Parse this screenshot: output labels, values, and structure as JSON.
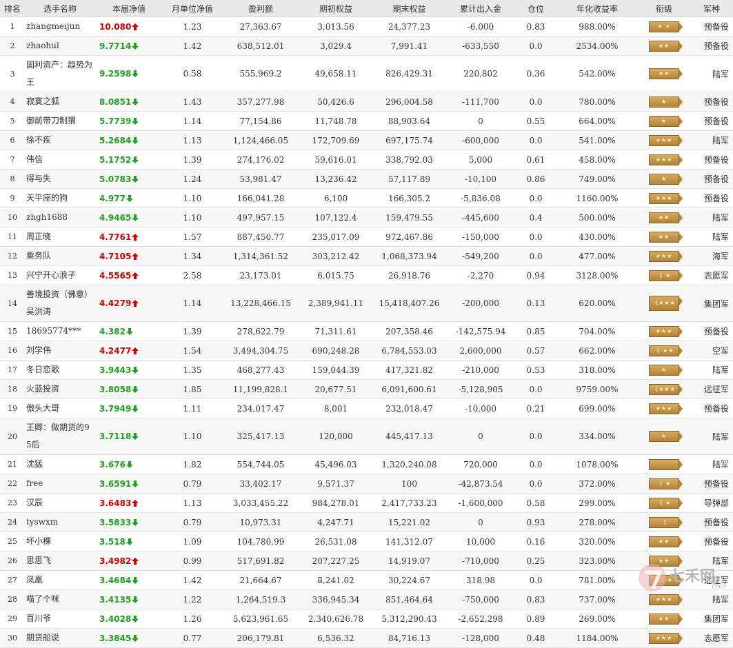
{
  "headers": [
    "排名",
    "选手名称",
    "本届净值",
    "月单位净值",
    "盈利额",
    "期初权益",
    "期末权益",
    "累计出入金",
    "仓位",
    "年化收益率",
    "衔级",
    "军种"
  ],
  "rows": [
    {
      "rank": "1",
      "name": "zhangmeijun",
      "nav": "10.080",
      "trend": "up",
      "monthly": "1.23",
      "profit": "27,363.67",
      "start": "3,013.56",
      "end": "24,377.23",
      "flow": "-6,000",
      "position": "0.83",
      "annual": "988.00%",
      "badge": "✦  ✦",
      "army": "预备役"
    },
    {
      "rank": "2",
      "name": "zhaohui",
      "nav": "9.7714",
      "trend": "down",
      "monthly": "1.42",
      "profit": "638,512.01",
      "start": "3,029.4",
      "end": "7,991.41",
      "flow": "-633,550",
      "position": "0.0",
      "annual": "2534.00%",
      "badge": "★★",
      "army": "预备役"
    },
    {
      "rank": "3",
      "name": "固利资产：趋势为王",
      "nav": "9.2598",
      "trend": "down",
      "monthly": "0.58",
      "profit": "555,969.2",
      "start": "49,658.11",
      "end": "826,429.31",
      "flow": "220,802",
      "position": "0.36",
      "annual": "542.00%",
      "badge": "★★",
      "army": "陆军"
    },
    {
      "rank": "4",
      "name": "寂寞之狐",
      "nav": "8.0851",
      "trend": "down",
      "monthly": "1.43",
      "profit": "357,277.98",
      "start": "50,426.6",
      "end": "296,004.58",
      "flow": "-111,700",
      "position": "0.0",
      "annual": "780.00%",
      "badge": "★",
      "army": "预备役"
    },
    {
      "rank": "5",
      "name": "御前带刀制猬",
      "nav": "5.7739",
      "trend": "down",
      "monthly": "1.14",
      "profit": "77,154.86",
      "start": "11,748.78",
      "end": "88,903.64",
      "flow": "0",
      "position": "0.55",
      "annual": "664.00%",
      "badge": "★",
      "army": "预备役"
    },
    {
      "rank": "6",
      "name": "徐不疾",
      "nav": "5.2684",
      "trend": "down",
      "monthly": "1.13",
      "profit": "1,124,466.05",
      "start": "172,709.69",
      "end": "697,175.74",
      "flow": "-600,000",
      "position": "0.0",
      "annual": "541.00%",
      "badge": "★★★",
      "army": "陆军"
    },
    {
      "rank": "7",
      "name": "伟信",
      "nav": "5.1752",
      "trend": "down",
      "monthly": "1.39",
      "profit": "274,176.02",
      "start": "59,616.01",
      "end": "338,792.03",
      "flow": "5,000",
      "position": "0.61",
      "annual": "458.00%",
      "badge": "★★★",
      "army": "预备役"
    },
    {
      "rank": "8",
      "name": "得与失",
      "nav": "5.0783",
      "trend": "down",
      "monthly": "1.24",
      "profit": "53,981.47",
      "start": "13,236.42",
      "end": "57,117.89",
      "flow": "-10,100",
      "position": "0.86",
      "annual": "749.00%",
      "badge": "★",
      "army": "预备役"
    },
    {
      "rank": "9",
      "name": "天平座的狗",
      "nav": "4.977",
      "trend": "down",
      "monthly": "1.10",
      "profit": "166,041.28",
      "start": "6,100",
      "end": "166,305.2",
      "flow": "-5,836.08",
      "position": "0.0",
      "annual": "1160.00%",
      "badge": "★★★",
      "army": "预备役"
    },
    {
      "rank": "10",
      "name": "zhgh1688",
      "nav": "4.9465",
      "trend": "down",
      "monthly": "1.10",
      "profit": "497,957.15",
      "start": "107,122.4",
      "end": "159,479.55",
      "flow": "-445,600",
      "position": "0.4",
      "annual": "500.00%",
      "badge": "★★",
      "army": "陆军"
    },
    {
      "rank": "11",
      "name": "周正晓",
      "nav": "4.7761",
      "trend": "up",
      "monthly": "1.57",
      "profit": "887,450.77",
      "start": "235,017.09",
      "end": "972,467.86",
      "flow": "-150,000",
      "position": "0.0",
      "annual": "430.00%",
      "badge": "★★",
      "army": "陆军"
    },
    {
      "rank": "12",
      "name": "乘务队",
      "nav": "4.7105",
      "trend": "up",
      "monthly": "1.34",
      "profit": "1,314,361.52",
      "start": "303,212.42",
      "end": "1,068,373.94",
      "flow": "-549,200",
      "position": "0.0",
      "annual": "477.00%",
      "badge": "★★★",
      "army": "海军"
    },
    {
      "rank": "13",
      "name": "兴宁开心浪子",
      "nav": "4.5565",
      "trend": "up",
      "monthly": "2.58",
      "profit": "23,173.01",
      "start": "6,015.75",
      "end": "26,918.76",
      "flow": "-2,270",
      "position": "0.94",
      "annual": "3128.00%",
      "badge": "《 ★",
      "army": "志愿军"
    },
    {
      "rank": "14",
      "name": "善境投资（佛意）吴洪涛",
      "nav": "4.4279",
      "trend": "up",
      "monthly": "1.14",
      "profit": "13,228,466.15",
      "start": "2,389,941.11",
      "end": "15,418,407.26",
      "flow": "-200,000",
      "position": "0.13",
      "annual": "620.00%",
      "badge": "《★★★",
      "army": "集团军"
    },
    {
      "rank": "15",
      "name": "18695774***",
      "nav": "4.382",
      "trend": "down",
      "monthly": "1.39",
      "profit": "278,622.79",
      "start": "71,311.61",
      "end": "207,358.46",
      "flow": "-142,575.94",
      "position": "0.85",
      "annual": "704.00%",
      "badge": "★★★",
      "army": "预备役"
    },
    {
      "rank": "16",
      "name": "刘学伟",
      "nav": "4.2477",
      "trend": "up",
      "monthly": "1.54",
      "profit": "3,494,304.75",
      "start": "690,248.28",
      "end": "6,784,553.03",
      "flow": "2,600,000",
      "position": "0.57",
      "annual": "662.00%",
      "badge": "《 ★★",
      "army": "空军"
    },
    {
      "rank": "17",
      "name": "冬日恋歌",
      "nav": "3.9443",
      "trend": "down",
      "monthly": "1.35",
      "profit": "468,277.43",
      "start": "159,044.39",
      "end": "417,321.82",
      "flow": "-210,000",
      "position": "0.53",
      "annual": "318.00%",
      "badge": "★",
      "army": "陆军"
    },
    {
      "rank": "18",
      "name": "火蓝投资",
      "nav": "3.8058",
      "trend": "down",
      "monthly": "1.85",
      "profit": "11,199,828.1",
      "start": "20,677.51",
      "end": "6,091,600.61",
      "flow": "-5,128,905",
      "position": "0.0",
      "annual": "9759.00%",
      "badge": "《★★★",
      "army": "远征军"
    },
    {
      "rank": "19",
      "name": "傲头大哥",
      "nav": "3.7949",
      "trend": "down",
      "monthly": "1.11",
      "profit": "234,017.47",
      "start": "8,001",
      "end": "232,018.47",
      "flow": "-10,000",
      "position": "0.21",
      "annual": "699.00%",
      "badge": "★★★",
      "army": "预备役"
    },
    {
      "rank": "20",
      "name": "王卿：做期货的95后",
      "nav": "3.7118",
      "trend": "down",
      "monthly": "1.10",
      "profit": "325,417.13",
      "start": "120,000",
      "end": "445,417.13",
      "flow": "0",
      "position": "0.0",
      "annual": "334.00%",
      "badge": "★",
      "army": "陆军"
    },
    {
      "rank": "21",
      "name": "沈猛",
      "nav": "3.676",
      "trend": "down",
      "monthly": "1.82",
      "profit": "554,744.05",
      "start": "45,496.03",
      "end": "1,320,240.08",
      "flow": "720,000",
      "position": "0.0",
      "annual": "1078.00%",
      "badge": "",
      "army": "陆军"
    },
    {
      "rank": "22",
      "name": "free",
      "nav": "3.6591",
      "trend": "down",
      "monthly": "0.79",
      "profit": "33,402.17",
      "start": "9,571.37",
      "end": "100",
      "flow": "-42,873.54",
      "position": "0.0",
      "annual": "372.00%",
      "badge": "《 ★",
      "army": "预备役"
    },
    {
      "rank": "23",
      "name": "汉辰",
      "nav": "3.6483",
      "trend": "up",
      "monthly": "1.13",
      "profit": "3,033,455.22",
      "start": "984,278.01",
      "end": "2,417,733.23",
      "flow": "-1,600,000",
      "position": "0.58",
      "annual": "299.00%",
      "badge": "《 ★",
      "army": "导弹部"
    },
    {
      "rank": "24",
      "name": "tyswxm",
      "nav": "3.5833",
      "trend": "down",
      "monthly": "0.79",
      "profit": "10,973.31",
      "start": "4,247.71",
      "end": "15,221.02",
      "flow": "0",
      "position": "0.93",
      "annual": "278.00%",
      "badge": "《",
      "army": "预备役"
    },
    {
      "rank": "25",
      "name": "坏小稞",
      "nav": "3.518",
      "trend": "down",
      "monthly": "1.09",
      "profit": "104,780.99",
      "start": "26,531.08",
      "end": "141,312.07",
      "flow": "10,000",
      "position": "0.16",
      "annual": "320.00%",
      "badge": "★★",
      "army": "预备役"
    },
    {
      "rank": "26",
      "name": "思思飞",
      "nav": "3.4982",
      "trend": "up",
      "monthly": "0.99",
      "profit": "517,691.82",
      "start": "207,227.25",
      "end": "14,919.07",
      "flow": "-710,000",
      "position": "0.25",
      "annual": "323.00%",
      "badge": "★★",
      "army": "陆军"
    },
    {
      "rank": "27",
      "name": "凤凰",
      "nav": "3.4684",
      "trend": "down",
      "monthly": "1.42",
      "profit": "21,664.67",
      "start": "8,241.02",
      "end": "30,224.67",
      "flow": "318.98",
      "position": "0.0",
      "annual": "781.00%",
      "badge": "《《 ★",
      "army": "远征军"
    },
    {
      "rank": "28",
      "name": "喵了个咪",
      "nav": "3.4135",
      "trend": "down",
      "monthly": "1.22",
      "profit": "1,264,519.3",
      "start": "336,945.34",
      "end": "851,464.64",
      "flow": "-750,000",
      "position": "0.83",
      "annual": "737.00%",
      "badge": "★★★",
      "army": "陆军"
    },
    {
      "rank": "29",
      "name": "百川爷",
      "nav": "3.4028",
      "trend": "down",
      "monthly": "1.26",
      "profit": "5,623,961.65",
      "start": "2,340,626.78",
      "end": "5,312,290.43",
      "flow": "-2,652,298",
      "position": "0.89",
      "annual": "269.00%",
      "badge": "★★",
      "army": "集团军"
    },
    {
      "rank": "30",
      "name": "期货船说",
      "nav": "3.3845",
      "trend": "down",
      "monthly": "0.77",
      "profit": "206,179.81",
      "start": "6,536.32",
      "end": "84,716.13",
      "flow": "-128,000",
      "position": "0.48",
      "annual": "1184.00%",
      "badge": "★★★",
      "army": "志愿军"
    }
  ],
  "watermark": {
    "text": "七禾网",
    "sub": "7hcn"
  },
  "colors": {
    "up": "#d00000",
    "down": "#22a022",
    "badge": "#c89a4e"
  }
}
